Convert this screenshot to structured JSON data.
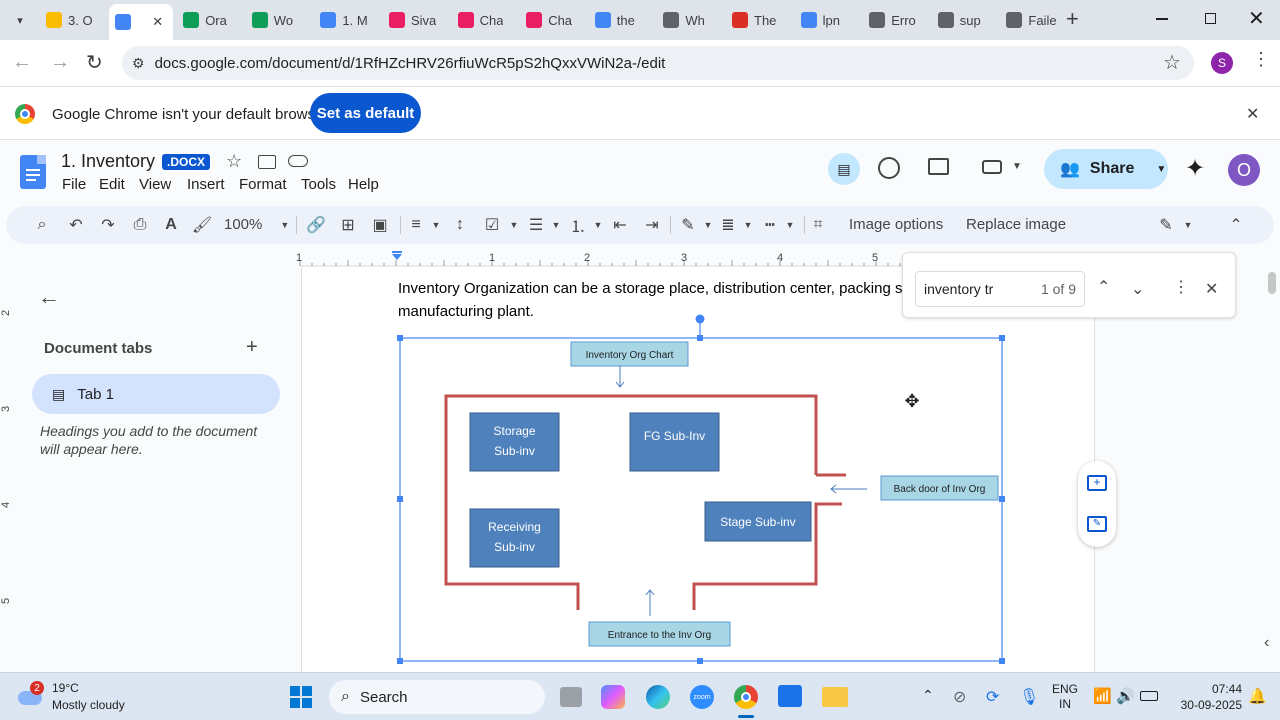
{
  "browser": {
    "tabs": [
      {
        "label": "3. O",
        "color": "#fbbc04",
        "icon": "drive-icon"
      },
      {
        "label": "",
        "color": "#4285f4",
        "icon": "docs-icon",
        "active": true
      },
      {
        "label": "Ora",
        "color": "#0f9d58",
        "icon": "sheets-icon"
      },
      {
        "label": "Wo",
        "color": "#0f9d58",
        "icon": "sheets-icon"
      },
      {
        "label": "1. M",
        "color": "#4285f4",
        "icon": "docs-icon"
      },
      {
        "label": "Siva",
        "color": "#e91e63",
        "icon": "youtube-icon"
      },
      {
        "label": "Cha",
        "color": "#e91e63",
        "icon": "youtube-icon"
      },
      {
        "label": "Cha",
        "color": "#e91e63",
        "icon": "youtube-icon"
      },
      {
        "label": "the",
        "color": "#4285f4",
        "icon": "google-icon"
      },
      {
        "label": "Wh",
        "color": "#5f6368",
        "icon": "globe-icon"
      },
      {
        "label": "The",
        "color": "#d93025",
        "icon": "tv-icon"
      },
      {
        "label": "lpn",
        "color": "#4285f4",
        "icon": "google-icon"
      },
      {
        "label": "Erro",
        "color": "#5f6368",
        "icon": "globe-icon"
      },
      {
        "label": "sup",
        "color": "#5f6368",
        "icon": "globe-icon"
      },
      {
        "label": "Faile",
        "color": "#5f6368",
        "icon": "globe-icon"
      }
    ],
    "url": "docs.google.com/document/d/1RfHZcHRV26rfiuWcR5pS2hQxxVWiN2a-/edit",
    "profile_initial": "S"
  },
  "infobar": {
    "message": "Google Chrome isn't your default browser",
    "button": "Set as default"
  },
  "doc": {
    "title": "1. Inventory",
    "badge": ".DOCX",
    "menu": [
      "File",
      "Edit",
      "View",
      "Insert",
      "Format",
      "Tools",
      "Help"
    ],
    "share": "Share",
    "account_initial": "O",
    "zoom": "100%",
    "image_options": "Image options",
    "replace_image": "Replace image",
    "ruler_numbers": [
      "1",
      "1",
      "2",
      "3",
      "4",
      "5"
    ],
    "vruler_numbers": [
      "2",
      "3",
      "4",
      "5"
    ]
  },
  "sidebar": {
    "title": "Document tabs",
    "tab": "Tab 1",
    "hint": "Headings you add to the document will appear here."
  },
  "body": {
    "line1": "Inventory Organization can be a storage place, distribution center, packing stat",
    "line2": "manufacturing plant."
  },
  "diagram": {
    "title": "Inventory Org Chart",
    "storage": [
      "Storage",
      "Sub-inv"
    ],
    "fg": "FG Sub-Inv",
    "receiving": [
      "Receiving",
      "Sub-inv"
    ],
    "stage": "Stage Sub-inv",
    "backdoor": "Back door of Inv Org",
    "entrance": "Entrance to the Inv Org"
  },
  "find": {
    "query": "inventory tr",
    "count": "1 of 9"
  },
  "taskbar": {
    "weather_badge": "2",
    "temp": "19°C",
    "condition": "Mostly cloudy",
    "search": "Search",
    "lang1": "ENG",
    "lang2": "IN",
    "time": "07:44",
    "date": "30-09-2025"
  }
}
